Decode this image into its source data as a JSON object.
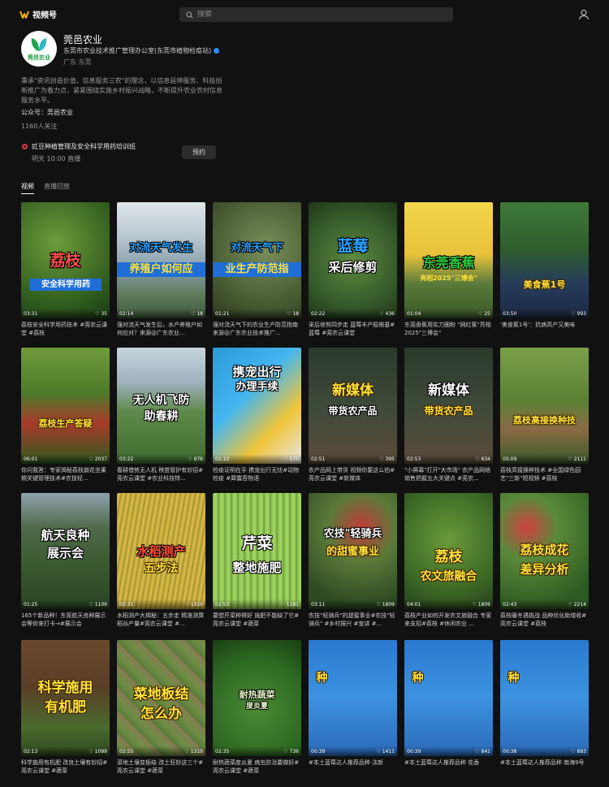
{
  "app": {
    "name": "视频号"
  },
  "search": {
    "placeholder": "搜索"
  },
  "profile": {
    "name": "莞邑农业",
    "avatar_text": "莞邑农业",
    "org": "东莞市农业技术推广管理办公室(东莞市植物检疫站)",
    "location": "广东 东莞",
    "bio": "秉承\"资讯创造价值，信息服务三农\"的理念，以信息延伸服务、科技创新推广为着力点，紧紧围绕实施乡村振兴战略，不断提升农业农村信息服务水平。",
    "official_account": "公众号：莞邑农业",
    "followers": "1160人关注"
  },
  "live": {
    "title": "豇豆种植管理及安全科学用药培训班",
    "time": "明天 10:00 直播",
    "button": "预约"
  },
  "tabs": [
    {
      "label": "视频"
    },
    {
      "label": "直播回放"
    }
  ],
  "videos": [
    {
      "duration": "03:31",
      "likes": "35",
      "caption": "荔枝安全科学用药技术 #莞农云课堂 #荔枝",
      "overlay": "荔枝",
      "overlay2": "安全科学用药"
    },
    {
      "duration": "02:14",
      "likes": "18",
      "caption": "强对流天气发生后，水产养殖户如何应对？来源@广东农业...",
      "overlay": "对流天气发生",
      "overlay2": "养殖户如何应"
    },
    {
      "duration": "01:21",
      "likes": "18",
      "caption": "强对流天气下的农业生产防范指南 来源@广东农业技术推广...",
      "overlay": "对流天气下",
      "overlay2": "业生产防范指"
    },
    {
      "duration": "02:22",
      "likes": "436",
      "caption": "采后修剪四步走 蓝莓丰产稳根基#蓝莓 #莞农云课堂",
      "overlay": "蓝莓",
      "overlay2": "采后修剪"
    },
    {
      "duration": "01:04",
      "likes": "25",
      "caption": "东莞香蕉用实力圈粉 \"网红蕉\"亮相2025\"三博会\"",
      "overlay": "东莞香蕉",
      "overlay2": "亮相2025\"三博会\""
    },
    {
      "duration": "03:50",
      "likes": "993",
      "caption": "'美食蕉1号'：抗病高产又美味",
      "overlay": "美食蕉1号",
      "overlay2": ""
    },
    {
      "duration": "06:01",
      "likes": "2037",
      "caption": "你问我答：专家揭秘荔枝崩花坐果期关键管理技术#农技轻...",
      "overlay": "荔枝生产答疑",
      "overlay2": ""
    },
    {
      "duration": "03:22",
      "likes": "976",
      "caption": "春耕借势无人机 秧苗管护有妙招#莞农云课堂 #农业科技特...",
      "overlay": "无人机飞防",
      "overlay2": "助春耕"
    },
    {
      "duration": "01:10",
      "likes": "570",
      "caption": "检疫证明在手 携宠出行无忧#动物检疫 #犀露吾物语",
      "overlay": "携宠出行",
      "overlay2": "办理手续"
    },
    {
      "duration": "02:51",
      "likes": "395",
      "caption": "农产品网上带货 视频你要这么拍#莞农云课堂 #新媒体",
      "overlay": "新媒体",
      "overlay2": "带货农产品"
    },
    {
      "duration": "02:53",
      "likes": "634",
      "caption": "\"小屏幕\"打开\"大市场\" 农产品网络销售把握五大关键点 #莞农...",
      "overlay": "新媒体",
      "overlay2": "带货农产品"
    },
    {
      "duration": "05:09",
      "likes": "2111",
      "caption": "荔枝高接换种技术 #全国绿色园艺\"三新\"短视频 #荔枝",
      "overlay": "荔枝高接换种技",
      "overlay2": ""
    },
    {
      "duration": "01:25",
      "likes": "1109",
      "caption": "165个新品种！东莞航天良种展示会等你来打卡→#展示会",
      "overlay": "航天良种",
      "overlay2": "展示会"
    },
    {
      "duration": "02:31",
      "likes": "1310",
      "caption": "水稻测产大揭秘：五步走 精准测算稻谷产量#莞农云课堂 #...",
      "overlay": "水稻测产",
      "overlay2": "五步法"
    },
    {
      "duration": "02:53",
      "likes": "1181",
      "caption": "要想芹菜种得好 施肥不能缺了它#莞农云课堂 #蔬菜",
      "overlay": "芹菜",
      "overlay2": "整地施肥"
    },
    {
      "duration": "03:11",
      "likes": "1809",
      "caption": "农技\"轻骑兵\"的甜蜜事业#农技\"轻骑兵\" #乡村振兴 #宣讲 #...",
      "overlay": "农技\"轻骑兵",
      "overlay2": "的甜蜜事业"
    },
    {
      "duration": "04:01",
      "likes": "1809",
      "caption": "荔枝产业如何开发农文旅融合 专家来支招#荔枝 #休闲农业 ...",
      "overlay": "荔枝",
      "overlay2": "农文旅融合"
    },
    {
      "duration": "02:43",
      "likes": "2214",
      "caption": "荔枝暖冬遇挑战 品种优化助增收#莞农云课堂 #荔枝",
      "overlay": "荔枝成花",
      "overlay2": "差异分析"
    },
    {
      "duration": "02:13",
      "likes": "1099",
      "caption": "科学施用有机肥 改良土壤有妙招#莞农云课堂 #蔬菜",
      "overlay": "科学施用",
      "overlay2": "有机肥"
    },
    {
      "duration": "02:55",
      "likes": "1310",
      "caption": "菜地土壤变板结 改土狂妙这三个#莞农云课堂 #蔬菜",
      "overlay": "菜地板结",
      "overlay2": "怎么办"
    },
    {
      "duration": "02:35",
      "likes": "736",
      "caption": "耐热蔬菜度炎夏 病虫防治要做好#莞农云课堂 #蔬菜",
      "overlay": "耐热蔬菜",
      "overlay2": "度炎夏"
    },
    {
      "duration": "00:39",
      "likes": "1411",
      "caption": "#本土蓝莓达人推荐品种 法新",
      "overlay": "种",
      "overlay2": ""
    },
    {
      "duration": "00:39",
      "likes": "841",
      "caption": "#本土蓝莓达人推荐品种 花香",
      "overlay": "种",
      "overlay2": ""
    },
    {
      "duration": "00:38",
      "likes": "893",
      "caption": "#本土蓝莓达人推荐品种 南海9号",
      "overlay": "种",
      "overlay2": ""
    }
  ],
  "colors": {
    "background": "#111111",
    "accent_live": "#e23b3b",
    "verify": "#2f8cff"
  }
}
